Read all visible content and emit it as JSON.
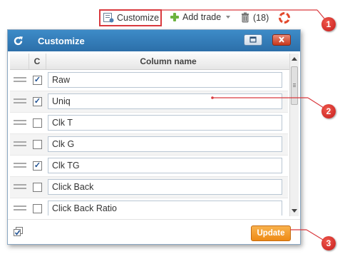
{
  "toolbar": {
    "customize_label": "Customize",
    "add_trade_label": "Add trade",
    "trash_count": "(18)"
  },
  "dialog": {
    "title": "Customize",
    "columns": {
      "check": "C",
      "name": "Column name"
    },
    "rows": [
      {
        "name": "Raw",
        "checked": true
      },
      {
        "name": "Uniq",
        "checked": true
      },
      {
        "name": "Clk T",
        "checked": false
      },
      {
        "name": "Clk G",
        "checked": false
      },
      {
        "name": "Clk TG",
        "checked": true
      },
      {
        "name": "Click Back",
        "checked": false
      },
      {
        "name": "Click Back Ratio",
        "checked": false
      }
    ],
    "update_label": "Update"
  },
  "callouts": [
    "1",
    "2",
    "3"
  ],
  "colors": {
    "titlebar": "#2c6fa9",
    "highlight": "#d9393e",
    "update_button": "#ee8a15"
  }
}
